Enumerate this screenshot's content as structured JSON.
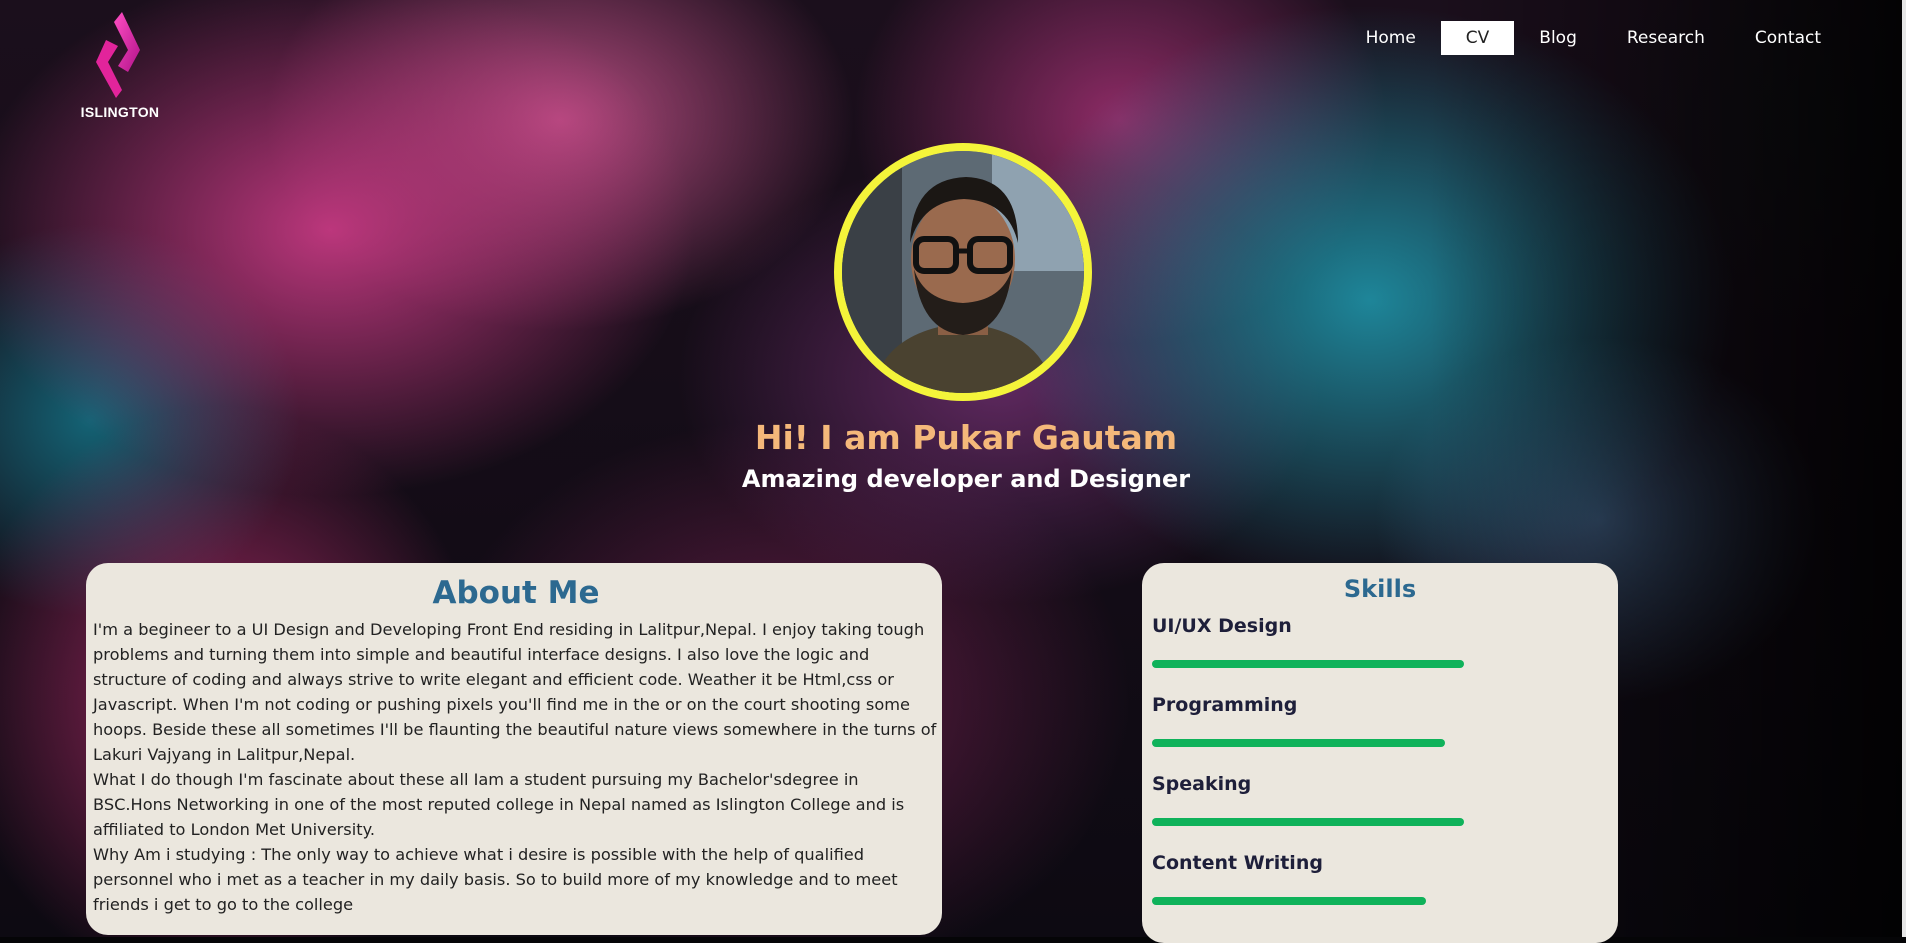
{
  "brand": {
    "name": "ISLINGTON",
    "accent": "#e2249b"
  },
  "nav": {
    "items": [
      {
        "label": "Home"
      },
      {
        "label": "CV",
        "active": true
      },
      {
        "label": "Blog"
      },
      {
        "label": "Research"
      },
      {
        "label": "Contact"
      }
    ]
  },
  "hero": {
    "title": "Hi! I am Pukar Gautam",
    "subtitle": "Amazing developer and Designer",
    "avatar_border_color": "#f4f43a",
    "title_color": "#f4b87a"
  },
  "about": {
    "title": "About Me",
    "paragraphs": [
      "I'm a begineer to a UI Design and Developing Front End residing in Lalitpur,Nepal. I enjoy taking tough problems and turning them into simple and beautiful interface designs. I also love the logic and structure of coding and always strive to write elegant and efficient code. Weather it be Html,css or Javascript. When I'm not coding or pushing pixels you'll find me in the or on the court shooting some hoops. Beside these all sometimes I'll be flaunting the beautiful nature views somewhere in the turns of Lakuri Vajyang in Lalitpur,Nepal.",
      "What I do though I'm fascinate about these all Iam a student pursuing my Bachelor'sdegree in BSC.Hons Networking in one of the most reputed college in Nepal named as Islington College and is affiliated to London Met University.",
      "Why Am i studying : The only way to achieve what i desire is possible with the help of qualified personnel who i met as a teacher in my daily basis. So to build more of my knowledge and to meet friends i get to go to the college"
    ]
  },
  "skills": {
    "title": "Skills",
    "bar_color": "#0fb25a",
    "items": [
      {
        "name": "UI/UX Design",
        "level": 0.82
      },
      {
        "name": "Programming",
        "level": 0.77
      },
      {
        "name": "Speaking",
        "level": 0.82
      },
      {
        "name": "Content Writing",
        "level": 0.72
      }
    ]
  }
}
